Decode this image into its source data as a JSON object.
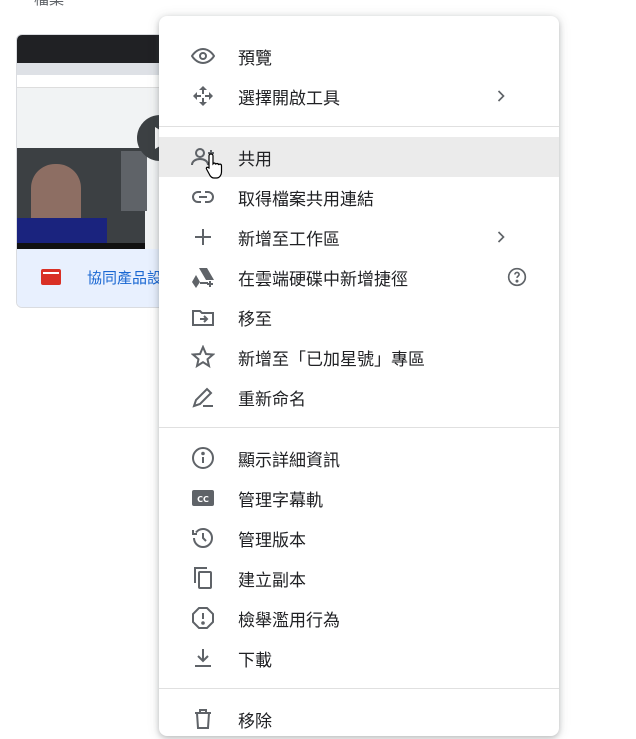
{
  "background": {
    "top_cut_text": "檔案",
    "file_name": "協同產品設"
  },
  "menu": {
    "groups": [
      [
        {
          "label": "預覽",
          "icon": "eye-icon"
        },
        {
          "label": "選擇開啟工具",
          "icon": "move-arrows-icon",
          "submenu": true
        }
      ],
      [
        {
          "label": "共用",
          "icon": "person-add-icon",
          "hover": true
        },
        {
          "label": "取得檔案共用連結",
          "icon": "link-icon"
        },
        {
          "label": "新增至工作區",
          "icon": "plus-icon",
          "submenu": true
        },
        {
          "label": "在雲端硬碟中新增捷徑",
          "icon": "drive-shortcut-icon",
          "help": true
        },
        {
          "label": "移至",
          "icon": "move-folder-icon"
        },
        {
          "label": "新增至「已加星號」專區",
          "icon": "star-icon"
        },
        {
          "label": "重新命名",
          "icon": "pencil-icon"
        }
      ],
      [
        {
          "label": "顯示詳細資訊",
          "icon": "info-icon"
        },
        {
          "label": "管理字幕軌",
          "icon": "captions-icon"
        },
        {
          "label": "管理版本",
          "icon": "history-icon"
        },
        {
          "label": "建立副本",
          "icon": "copy-icon"
        },
        {
          "label": "檢舉濫用行為",
          "icon": "report-icon"
        },
        {
          "label": "下載",
          "icon": "download-icon"
        }
      ],
      [
        {
          "label": "移除",
          "icon": "trash-icon"
        }
      ]
    ]
  }
}
